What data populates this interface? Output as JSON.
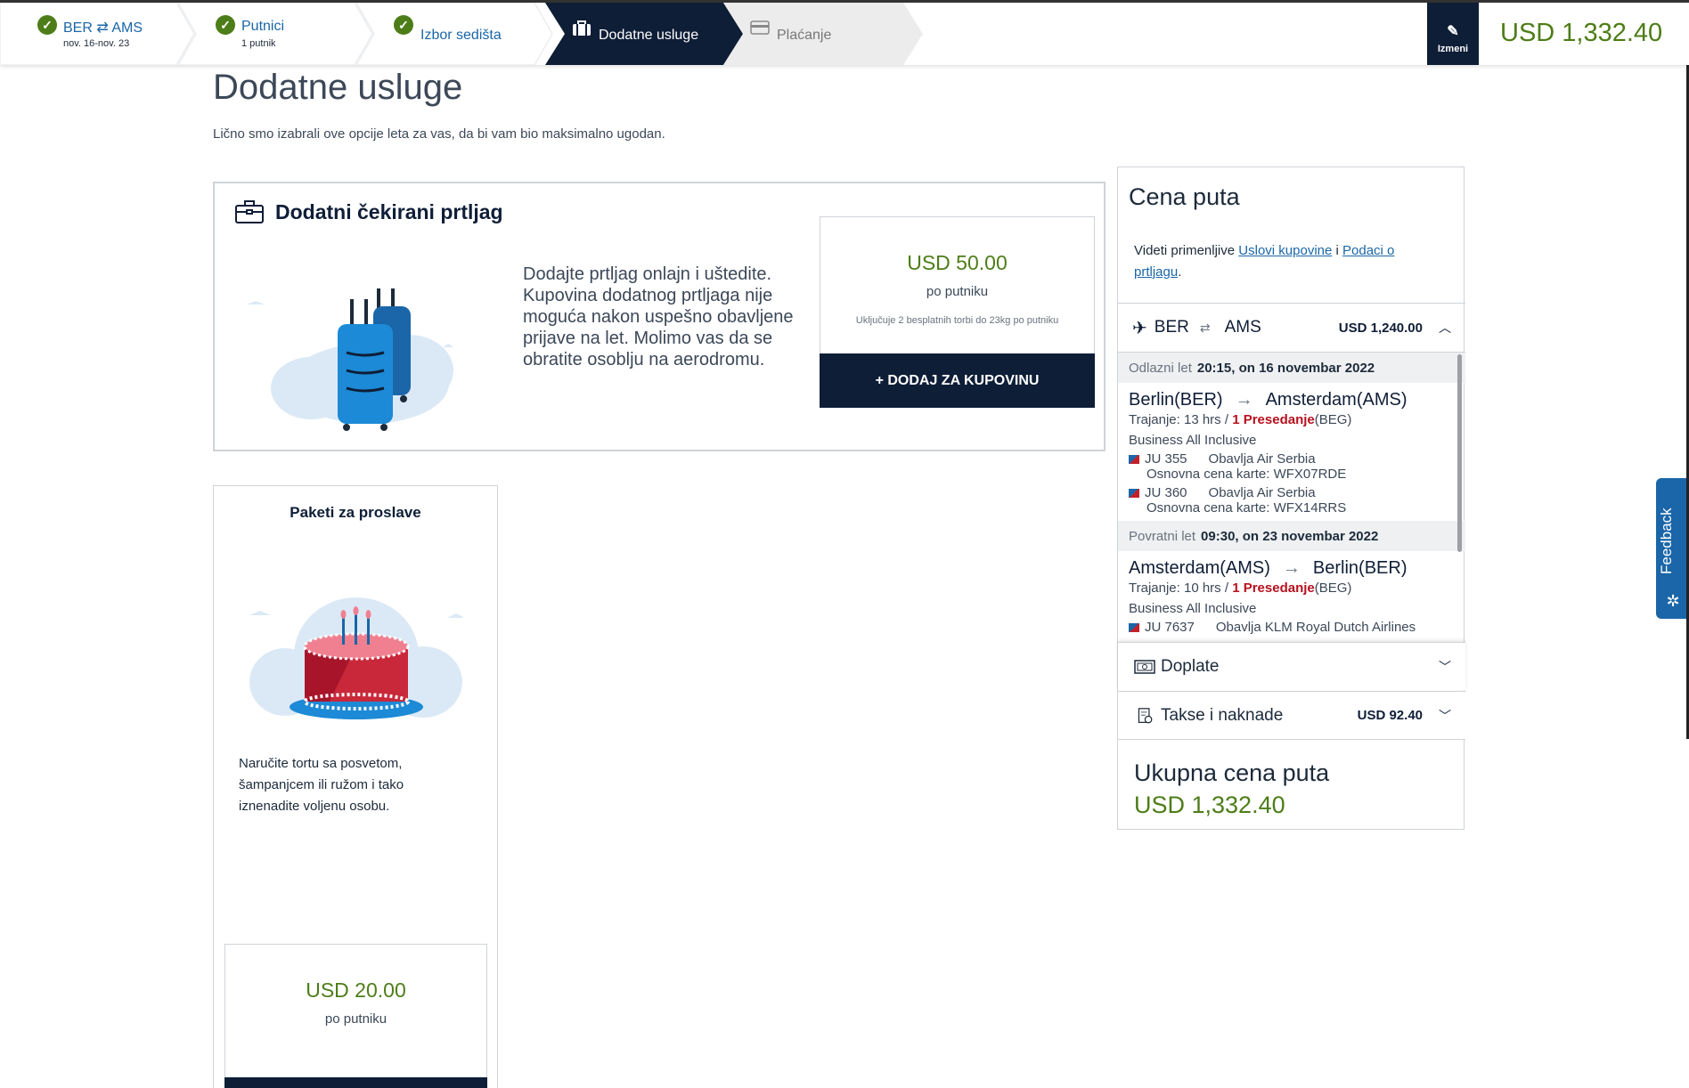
{
  "progress": {
    "steps": [
      {
        "title": "BER ⇄ AMS",
        "sub": "nov. 16-nov. 23",
        "state": "done"
      },
      {
        "title": "Putnici",
        "sub": "1 putnik",
        "state": "done"
      },
      {
        "title": "Izbor sedišta",
        "sub": "",
        "state": "done"
      },
      {
        "title": "Dodatne usluge",
        "sub": "",
        "state": "active"
      },
      {
        "title": "Plaćanje",
        "sub": "",
        "state": "disabled"
      }
    ],
    "edit_label": "Izmeni",
    "total": "USD 1,332.40"
  },
  "page": {
    "title": "Dodatne usluge",
    "subtitle": "Lično smo izabrali ove opcije leta za vas, da bi vam bio maksimalno ugodan."
  },
  "baggage": {
    "title": "Dodatni čekirani prtljag",
    "description": "Dodajte prtljag onlajn i uštedite. Kupovina dodatnog prtljaga nije moguća nakon uspešno obavljene prijave na let. Molimo vas da se obratite osoblju na aerodromu.",
    "price": "USD 50.00",
    "per": "po putniku",
    "note": "Uključuje 2 besplatnih torbi do 23kg po putniku",
    "button": "+ DODAJ ZA KUPOVINU"
  },
  "celebration": {
    "title": "Paketi za proslave",
    "description": "Naručite tortu sa posvetom, šampanjcem ili ružom i tako iznenadite voljenu osobu.",
    "price": "USD 20.00",
    "per": "po putniku"
  },
  "summary": {
    "title": "Cena puta",
    "terms_prefix": "Videti primenljive ",
    "terms_link1": "Uslovi kupovine",
    "terms_and": " i ",
    "terms_link2": "Podaci o prtljagu",
    "terms_suffix": ".",
    "route_from": "BER",
    "route_to": "AMS",
    "route_price": "USD 1,240.00",
    "outbound": {
      "label": "Odlazni let",
      "datetime": "20:15, on 16 novembar 2022",
      "from": "Berlin(BER)",
      "to": "Amsterdam(AMS)",
      "duration": "Trajanje: 13 hrs",
      "stops": "1 Presedanje",
      "via": "(BEG)",
      "class": "Business All Inclusive",
      "segments": [
        {
          "flight": "JU 355",
          "operator": "Obavlja Air Serbia",
          "fare": "Osnovna cena karte: WFX07RDE"
        },
        {
          "flight": "JU 360",
          "operator": "Obavlja Air Serbia",
          "fare": "Osnovna cena karte: WFX14RRS"
        }
      ]
    },
    "inbound": {
      "label": "Povratni let",
      "datetime": "09:30, on 23 novembar 2022",
      "from": "Amsterdam(AMS)",
      "to": "Berlin(BER)",
      "duration": "Trajanje: 10 hrs",
      "stops": "1 Presedanje",
      "via": "(BEG)",
      "class": "Business All Inclusive",
      "segments": [
        {
          "flight": "JU 7637",
          "operator": "Obavlja KLM Royal Dutch Airlines",
          "fare": ""
        }
      ]
    },
    "doplate_label": "Doplate",
    "takse_label": "Takse i naknade",
    "takse_amount": "USD 92.40",
    "total_label": "Ukupna cena puta",
    "total_value": "USD 1,332.40"
  },
  "feedback_label": "Feedback",
  "colors": {
    "navy": "#0f1e37",
    "green": "#4d7d18",
    "link": "#1a66a8",
    "red": "#b8101e"
  }
}
